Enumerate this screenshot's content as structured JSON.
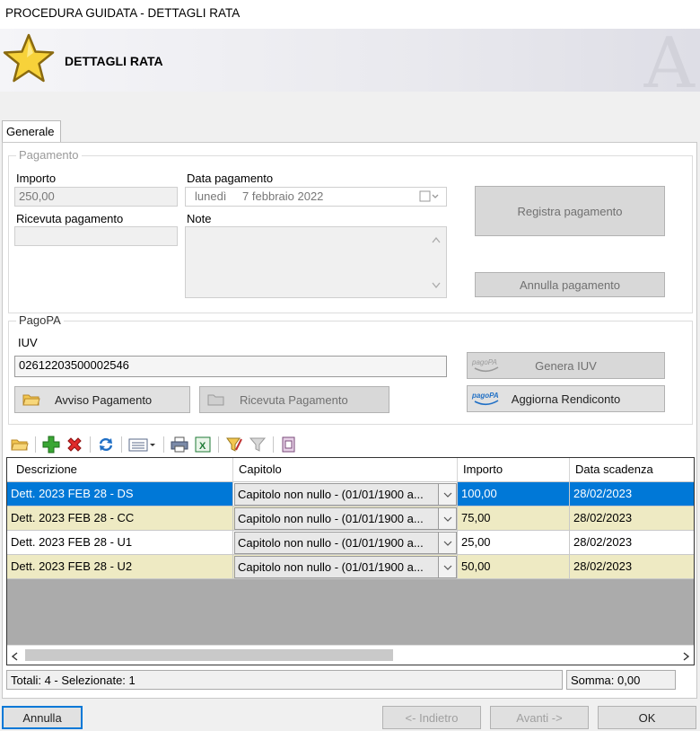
{
  "window": {
    "title": "PROCEDURA GUIDATA - DETTAGLI RATA"
  },
  "header": {
    "title": "DETTAGLI RATA",
    "watermark": "A"
  },
  "tabs": [
    {
      "label": "Generale"
    }
  ],
  "pagamento": {
    "group_label": "Pagamento",
    "importo_label": "Importo",
    "importo_value": "250,00",
    "data_label": "Data pagamento",
    "data_day": "lunedì",
    "data_value": "7  febbraio  2022",
    "ricevuta_label": "Ricevuta pagamento",
    "ricevuta_value": "",
    "note_label": "Note",
    "note_value": "",
    "registra_label": "Registra pagamento",
    "annulla_label": "Annulla pagamento"
  },
  "pagopa": {
    "group_label": "PagoPA",
    "iuv_label": "IUV",
    "iuv_value": "02612203500002546",
    "genera_label": "Genera IUV",
    "aggiorna_label": "Aggiorna Rendiconto",
    "avviso_label": "Avviso Pagamento",
    "ricevuta_label": "Ricevuta Pagamento",
    "logo_text": "pagoPA"
  },
  "grid": {
    "columns": [
      "Descrizione",
      "Capitolo",
      "Importo",
      "Data scadenza"
    ],
    "rows": [
      {
        "descrizione": "Dett. 2023 FEB 28 -  DS",
        "capitolo": "Capitolo non nullo - (01/01/1900 a...",
        "importo": "100,00",
        "scadenza": "28/02/2023",
        "selected": true
      },
      {
        "descrizione": "Dett. 2023 FEB 28 -  CC",
        "capitolo": "Capitolo non nullo - (01/01/1900 a...",
        "importo": "75,00",
        "scadenza": "28/02/2023",
        "selected": false
      },
      {
        "descrizione": "Dett. 2023 FEB 28 -  U1",
        "capitolo": "Capitolo non nullo - (01/01/1900 a...",
        "importo": "25,00",
        "scadenza": "28/02/2023",
        "selected": false
      },
      {
        "descrizione": "Dett. 2023 FEB 28 -  U2",
        "capitolo": "Capitolo non nullo - (01/01/1900 a...",
        "importo": "50,00",
        "scadenza": "28/02/2023",
        "selected": false
      }
    ]
  },
  "status": {
    "totali": "Totali: 4 - Selezionate: 1",
    "somma": "Somma: 0,00"
  },
  "footer": {
    "annulla": "Annulla",
    "indietro": "<- Indietro",
    "avanti": "Avanti ->",
    "ok": "OK"
  },
  "colors": {
    "selected_row": "#0078d7",
    "alt_row": "#eeeac3",
    "accent": "#0078d7",
    "star": "#f7d23a"
  }
}
